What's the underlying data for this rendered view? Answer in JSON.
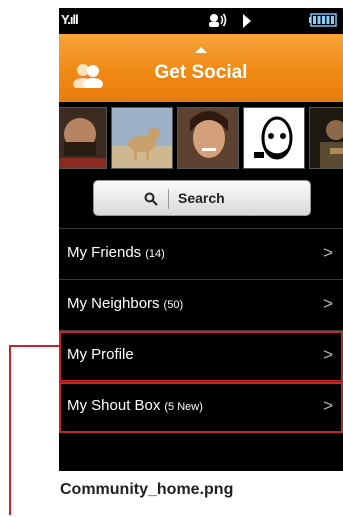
{
  "status_bar": {
    "signal_label": "Y.ıll"
  },
  "header": {
    "title": "Get Social",
    "people_icon": "people-icon",
    "up_arrow_icon": "up-arrow-icon"
  },
  "photos": [
    {
      "name": "man-with-beard",
      "colors": [
        "#4a3628",
        "#a67b5b",
        "#2a1c14"
      ]
    },
    {
      "name": "dog-on-beach",
      "colors": [
        "#8ea3b8",
        "#c9b28a",
        "#d8c7a3"
      ]
    },
    {
      "name": "smiling-woman",
      "colors": [
        "#6b4a34",
        "#c99472",
        "#3a2418"
      ]
    },
    {
      "name": "cartoon-face",
      "colors": [
        "#ffffff",
        "#000000",
        "#ffffff"
      ]
    },
    {
      "name": "man-with-guitar",
      "colors": [
        "#2a2418",
        "#7a6a4a",
        "#1a1410"
      ]
    }
  ],
  "search": {
    "label": "Search"
  },
  "list": [
    {
      "label": "My Friends",
      "count": "(14)",
      "highlighted": false
    },
    {
      "label": "My Neighbors",
      "count": "(50)",
      "highlighted": false
    },
    {
      "label": "My Profile",
      "count": "",
      "highlighted": true
    },
    {
      "label": "My Shout Box",
      "count": "(5 New)",
      "highlighted": true
    }
  ],
  "chevron": ">",
  "caption": "Community_home.png",
  "colors": {
    "header_top": "#f6a43a",
    "header_bottom": "#ea7d0c",
    "highlight": "#c1272d",
    "screen_bg": "#000000"
  }
}
